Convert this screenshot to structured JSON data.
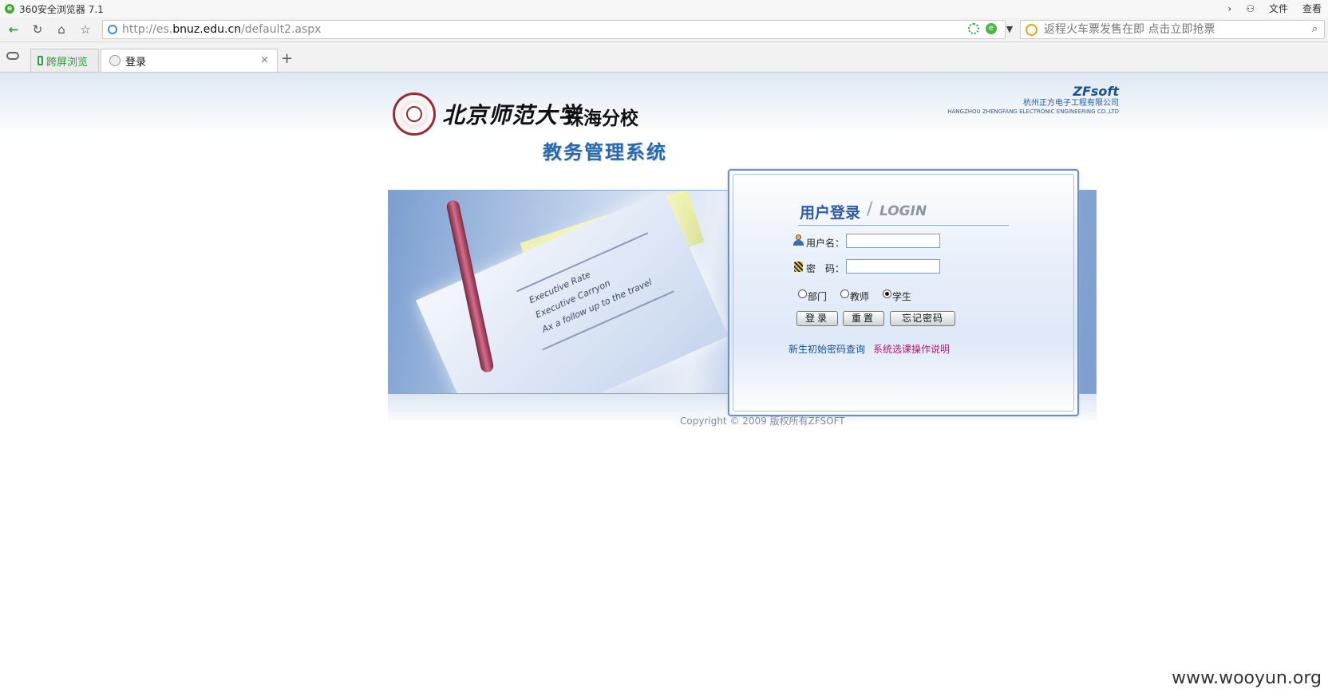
{
  "browser": {
    "title": "360安全浏览器 7.1",
    "menu": [
      "文件",
      "查看"
    ],
    "url_prefix": "http://es.",
    "url_domain": "bnuz.edu.cn",
    "url_path": "/default2.aspx",
    "search_placeholder": "返程火车票发售在即 点击立即抢票",
    "tabs": [
      {
        "label": "跨屏浏览"
      },
      {
        "label": "登录"
      }
    ],
    "new_tab": "+",
    "close_tab": "×"
  },
  "header": {
    "university": "北京师范大学",
    "branch": "珠海分校",
    "system_name": "教务管理系统",
    "vendor_brand": "ZFsoft",
    "vendor_cn": "杭州正方电子工程有限公司",
    "vendor_en": "HANGZHOU ZHENGFANG ELECTRONIC ENGINEERING CO.,LTD"
  },
  "photo": {
    "text1": "Executive Rate",
    "text2": "Executive Carryon",
    "text3": "Ax a follow up to the travel"
  },
  "login": {
    "title": "用户登录",
    "title_en": "LOGIN",
    "username_label": "用户名：",
    "password_label": "密　码：",
    "username_value": "",
    "password_value": "",
    "roles": [
      {
        "label": "部门",
        "selected": false
      },
      {
        "label": "教师",
        "selected": false
      },
      {
        "label": "学生",
        "selected": true
      }
    ],
    "login_button": "登录",
    "reset_button": "重置",
    "forgot_button": "忘记密码",
    "link_initial_password": "新生初始密码查询",
    "link_course_guide": "系统选课操作说明"
  },
  "footer": {
    "copyright": "Copyright © 2009 版权所有ZFSOFT"
  },
  "watermark": "www.wooyun.org"
}
